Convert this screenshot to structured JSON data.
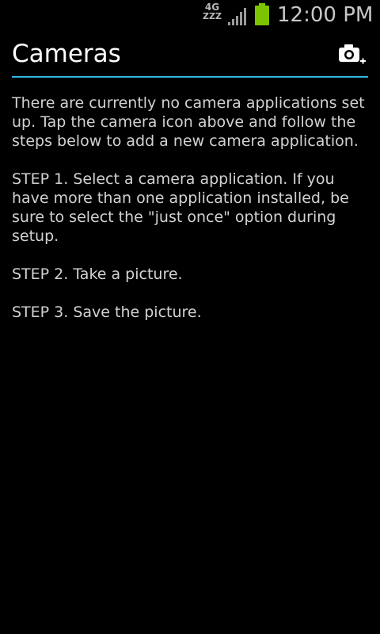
{
  "status_bar": {
    "network_type_top": "4G",
    "network_type_bottom": "ZZZ",
    "signal_icon": "signal-bars-icon",
    "battery_icon": "battery-icon",
    "battery_color": "#7cc400",
    "time": "12:00 PM"
  },
  "action_bar": {
    "title": "Cameras",
    "add_camera_icon": "add-camera-icon",
    "accent_color": "#33b5e5"
  },
  "content": {
    "intro": "There are currently no camera applications set up. Tap the camera icon above and follow the steps below to add a new camera application.",
    "step1": "STEP 1. Select a camera application. If you have more than one application installed, be sure to select the \"just once\" option during setup.",
    "step2": "STEP 2. Take a picture.",
    "step3": "STEP 3. Save the picture."
  }
}
